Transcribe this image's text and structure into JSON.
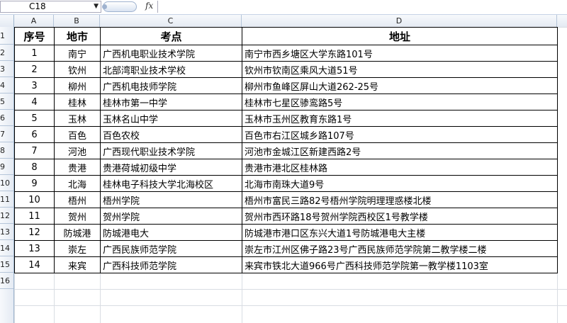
{
  "namebox": {
    "cell": "C18"
  },
  "formula_bar": {
    "fx_label": "fx",
    "value": ""
  },
  "columns": [
    "A",
    "B",
    "C",
    "D"
  ],
  "row_numbers": [
    "1",
    "2",
    "3",
    "4",
    "5",
    "6",
    "7",
    "8",
    "9",
    "10",
    "11",
    "12",
    "13",
    "14",
    "15",
    "16"
  ],
  "table": {
    "headers": [
      "序号",
      "地市",
      "考点",
      "地址"
    ],
    "rows": [
      [
        "1",
        "南宁",
        "广西机电职业技术学院",
        "南宁市西乡塘区大学东路101号"
      ],
      [
        "2",
        "钦州",
        "北部湾职业技术学校",
        "钦州市钦南区乘风大道51号"
      ],
      [
        "3",
        "柳州",
        "广西机电技师学院",
        "柳州市鱼峰区屏山大道262-25号"
      ],
      [
        "4",
        "桂林",
        "桂林市第一中学",
        "桂林市七星区骖鸾路5号"
      ],
      [
        "5",
        "玉林",
        "玉林名山中学",
        "玉林市玉州区教育东路1号"
      ],
      [
        "6",
        "百色",
        "百色农校",
        "百色市右江区城乡路107号"
      ],
      [
        "7",
        "河池",
        "广西现代职业技术学院",
        "河池市金城江区新建西路2号"
      ],
      [
        "8",
        "贵港",
        "贵港荷城初级中学",
        "贵港市港北区桂林路"
      ],
      [
        "9",
        "北海",
        "桂林电子科技大学北海校区",
        "北海市南珠大道9号"
      ],
      [
        "10",
        "梧州",
        "梧州学院",
        "梧州市富民三路82号梧州学院明理理惑楼北楼"
      ],
      [
        "11",
        "贺州",
        "贺州学院",
        "贺州市西环路18号贺州学院西校区1号教学楼"
      ],
      [
        "12",
        "防城港",
        "防城港电大",
        "防城港市港口区东兴大道1号防城港电大主楼"
      ],
      [
        "13",
        "崇左",
        "广西民族师范学院",
        "崇左市江州区佛子路23号广西民族师范学院第二教学楼二楼"
      ],
      [
        "14",
        "来宾",
        "广西科技师范学院",
        "来宾市铁北大道966号广西科技师范学院第一教学楼1103室"
      ]
    ]
  }
}
